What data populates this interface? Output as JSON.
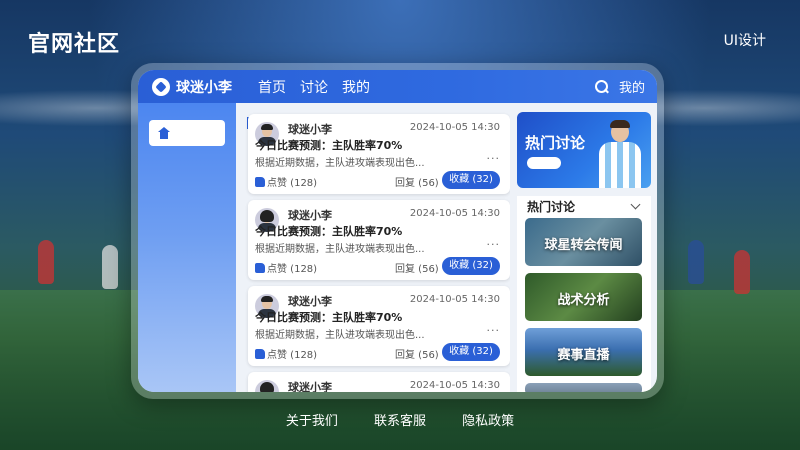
{
  "page": {
    "site_title": "官网社区",
    "ui_tag": "UI设计"
  },
  "app": {
    "brand": "球迷小李",
    "nav": [
      "首页",
      "讨论",
      "我的"
    ],
    "mine": "我的",
    "icons": {
      "logo": "football-logo-icon",
      "search": "search-icon",
      "home": "home-icon"
    }
  },
  "posts": [
    {
      "user": "球迷小李",
      "time": "2024-10-05 14:30",
      "title": "今日比赛预测：主队胜率70%",
      "excerpt": "根据近期数据，主队进攻端表现出色...",
      "more": "···",
      "like": "点赞 (128)",
      "reply": "回复 (56)",
      "fav": "收藏 (32)",
      "avatar": "male"
    },
    {
      "user": "球迷小李",
      "time": "2024-10-05 14:30",
      "title": "今日比赛预测：主队胜率70%",
      "excerpt": "根据近期数据，主队进攻端表现出色...",
      "more": "···",
      "like": "点赞 (128)",
      "reply": "回复 (56)",
      "fav": "收藏 (32)",
      "avatar": "female"
    },
    {
      "user": "球迷小李",
      "time": "2024-10-05 14:30",
      "title": "今日比赛预测：主队胜率70%",
      "excerpt": "根据近期数据，主队进攻端表现出色...",
      "more": "···",
      "like": "点赞 (128)",
      "reply": "回复 (56)",
      "fav": "收藏 (32)",
      "avatar": "male"
    },
    {
      "user": "球迷小李",
      "time": "2024-10-05 14:30",
      "avatar": "female"
    }
  ],
  "hot": {
    "banner_title": "热门讨论",
    "section_title": "热门讨论",
    "topics": [
      "球星转会传闻",
      "战术分析",
      "赛事直播"
    ]
  },
  "footer": [
    "关于我们",
    "联系客服",
    "隐私政策"
  ],
  "colors": {
    "primary": "#2a5fd6",
    "background": "#163763"
  }
}
